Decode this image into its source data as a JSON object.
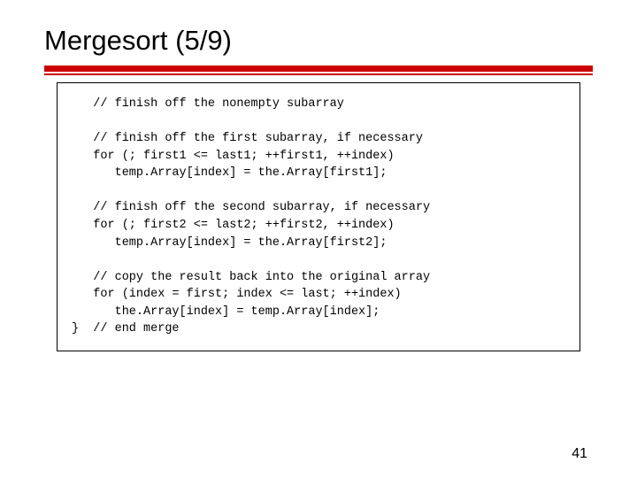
{
  "title": "Mergesort (5/9)",
  "code": {
    "l1": "   // finish off the nonempty subarray",
    "l2": "",
    "l3": "   // finish off the first subarray, if necessary",
    "l4": "   for (; first1 <= last1; ++first1, ++index)",
    "l5": "      temp.Array[index] = the.Array[first1];",
    "l6": "",
    "l7": "   // finish off the second subarray, if necessary",
    "l8": "   for (; first2 <= last2; ++first2, ++index)",
    "l9": "      temp.Array[index] = the.Array[first2];",
    "l10": "",
    "l11": "   // copy the result back into the original array",
    "l12": "   for (index = first; index <= last; ++index)",
    "l13": "      the.Array[index] = temp.Array[index];",
    "l14": "}  // end merge"
  },
  "page_number": "41"
}
